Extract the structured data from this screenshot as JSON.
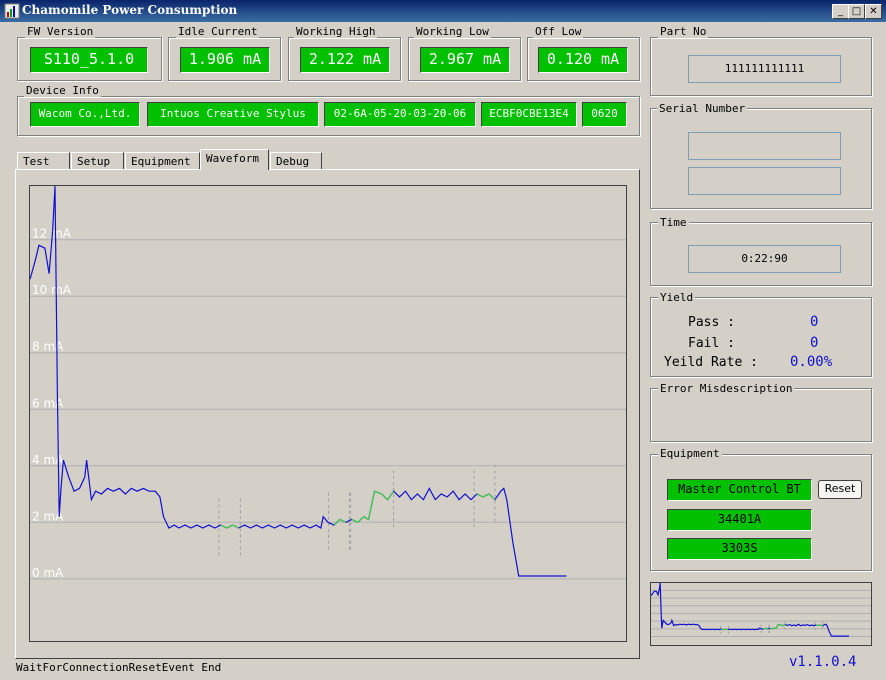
{
  "window": {
    "title": "Chamomile Power Consumption"
  },
  "readings": {
    "fw_version": {
      "label": "FW Version",
      "value": "S110_5.1.0"
    },
    "idle_current": {
      "label": "Idle Current",
      "value": "1.906 mA"
    },
    "working_high": {
      "label": "Working High",
      "value": "2.122 mA"
    },
    "working_low": {
      "label": "Working Low",
      "value": "2.967 mA"
    },
    "off_low": {
      "label": "Off Low",
      "value": "0.120 mA"
    }
  },
  "device_info": {
    "label": "Device Info",
    "items": [
      "Wacom Co.,Ltd.",
      "Intuos Creative Stylus",
      "02-6A-05-20-03-20-06",
      "ECBF0CBE13E4",
      "0620"
    ]
  },
  "tabs": [
    "Test",
    "Setup",
    "Equipment",
    "Waveform",
    "Debug"
  ],
  "active_tab": "Waveform",
  "part_no": {
    "label": "Part No",
    "value": "111111111111"
  },
  "serial_number": {
    "label": "Serial Number",
    "value1": "",
    "value2": ""
  },
  "time": {
    "label": "Time",
    "value": "0:22:90"
  },
  "yield": {
    "label": "Yield",
    "pass_label": "Pass :",
    "pass_value": "0",
    "fail_label": "Fail :",
    "fail_value": "0",
    "rate_label": "Yeild Rate :",
    "rate_value": "0.00%"
  },
  "error": {
    "label": "Error Misdescription",
    "value": ""
  },
  "equipment": {
    "label": "Equipment",
    "master": "Master Control BT",
    "reset_label": "Reset",
    "item1": "34401A",
    "item2": "3303S"
  },
  "status_text": "WaitForConnectionResetEvent End",
  "version": "v1.1.0.4",
  "colors": {
    "lcd": "#00c000",
    "trace": "#1010d0",
    "highlight": "#40d040",
    "grid": "#b0b0b0"
  },
  "chart_data": {
    "type": "line",
    "ylabel_ticks": [
      "12 mA",
      "10 mA",
      "8 mA",
      "6 mA",
      "4 mA",
      "2 mA",
      "0 mA"
    ],
    "yticks_values": [
      12,
      10,
      8,
      6,
      4,
      2,
      0
    ],
    "ylim": [
      -2.2,
      13.9
    ],
    "xlim": [
      0,
      100
    ],
    "grid": true,
    "series": [
      {
        "values": [
          [
            0,
            10.6
          ],
          [
            0.8,
            11.2
          ],
          [
            1.5,
            11.8
          ],
          [
            2.5,
            11.7
          ],
          [
            3.2,
            10.8
          ],
          [
            3.8,
            12.3
          ],
          [
            4.2,
            13.9
          ],
          [
            4.6,
            6.5
          ],
          [
            4.9,
            2.2
          ],
          [
            5.2,
            3.2
          ],
          [
            5.6,
            4.2
          ],
          [
            6.5,
            3.6
          ],
          [
            7.4,
            3.1
          ],
          [
            8.3,
            3.2
          ],
          [
            9.2,
            3.6
          ],
          [
            9.5,
            4.2
          ],
          [
            10.3,
            2.8
          ],
          [
            11,
            3.1
          ],
          [
            12,
            3
          ],
          [
            13,
            3.2
          ],
          [
            14,
            3.1
          ],
          [
            15,
            3.2
          ],
          [
            16,
            3
          ],
          [
            17,
            3.2
          ],
          [
            18,
            3.1
          ],
          [
            19,
            3.2
          ],
          [
            20,
            3.1
          ],
          [
            21,
            3.1
          ],
          [
            21.8,
            2.9
          ],
          [
            22.4,
            2.2
          ],
          [
            23.3,
            1.8
          ],
          [
            24.2,
            1.9
          ],
          [
            25,
            1.8
          ],
          [
            26,
            1.9
          ],
          [
            27,
            1.8
          ],
          [
            28,
            1.9
          ],
          [
            29,
            1.8
          ],
          [
            30,
            1.9
          ],
          [
            31,
            1.8
          ],
          [
            32,
            1.9
          ],
          [
            33,
            1.8
          ],
          [
            34,
            1.9
          ],
          [
            35,
            1.8
          ],
          [
            36,
            1.9
          ],
          [
            37,
            1.8
          ],
          [
            38,
            1.9
          ],
          [
            39,
            1.8
          ],
          [
            40,
            1.9
          ],
          [
            41,
            1.8
          ],
          [
            42,
            1.9
          ],
          [
            43,
            1.8
          ],
          [
            44,
            1.9
          ],
          [
            45,
            1.8
          ],
          [
            46,
            1.9
          ],
          [
            47,
            1.8
          ],
          [
            48,
            1.9
          ],
          [
            48.8,
            1.8
          ],
          [
            49.2,
            2.2
          ],
          [
            50,
            2
          ],
          [
            51,
            1.9
          ],
          [
            52,
            2.1
          ],
          [
            53,
            2
          ],
          [
            54,
            2.1
          ],
          [
            55,
            2
          ],
          [
            56,
            2.2
          ],
          [
            56.8,
            2.1
          ],
          [
            57.2,
            2.5
          ],
          [
            57.8,
            3.1
          ],
          [
            59,
            3
          ],
          [
            60,
            2.8
          ],
          [
            61,
            3.1
          ],
          [
            62,
            2.9
          ],
          [
            63,
            3.1
          ],
          [
            64,
            2.8
          ],
          [
            65,
            3
          ],
          [
            66,
            2.8
          ],
          [
            67,
            3.2
          ],
          [
            68,
            2.8
          ],
          [
            69,
            3
          ],
          [
            70,
            2.9
          ],
          [
            71,
            3.1
          ],
          [
            72,
            2.8
          ],
          [
            73,
            3
          ],
          [
            74,
            2.8
          ],
          [
            75,
            3
          ],
          [
            76,
            2.9
          ],
          [
            77,
            3
          ],
          [
            78,
            2.8
          ],
          [
            79,
            3.1
          ],
          [
            79.5,
            3.2
          ],
          [
            80,
            2.8
          ],
          [
            81,
            1.3
          ],
          [
            82,
            0.1
          ],
          [
            86,
            0.1
          ],
          [
            90,
            0.1
          ]
        ]
      }
    ],
    "highlights_x": [
      [
        31.7,
        35.3
      ],
      [
        50.1,
        53.6
      ],
      [
        53.8,
        61
      ],
      [
        74.5,
        78
      ]
    ]
  }
}
